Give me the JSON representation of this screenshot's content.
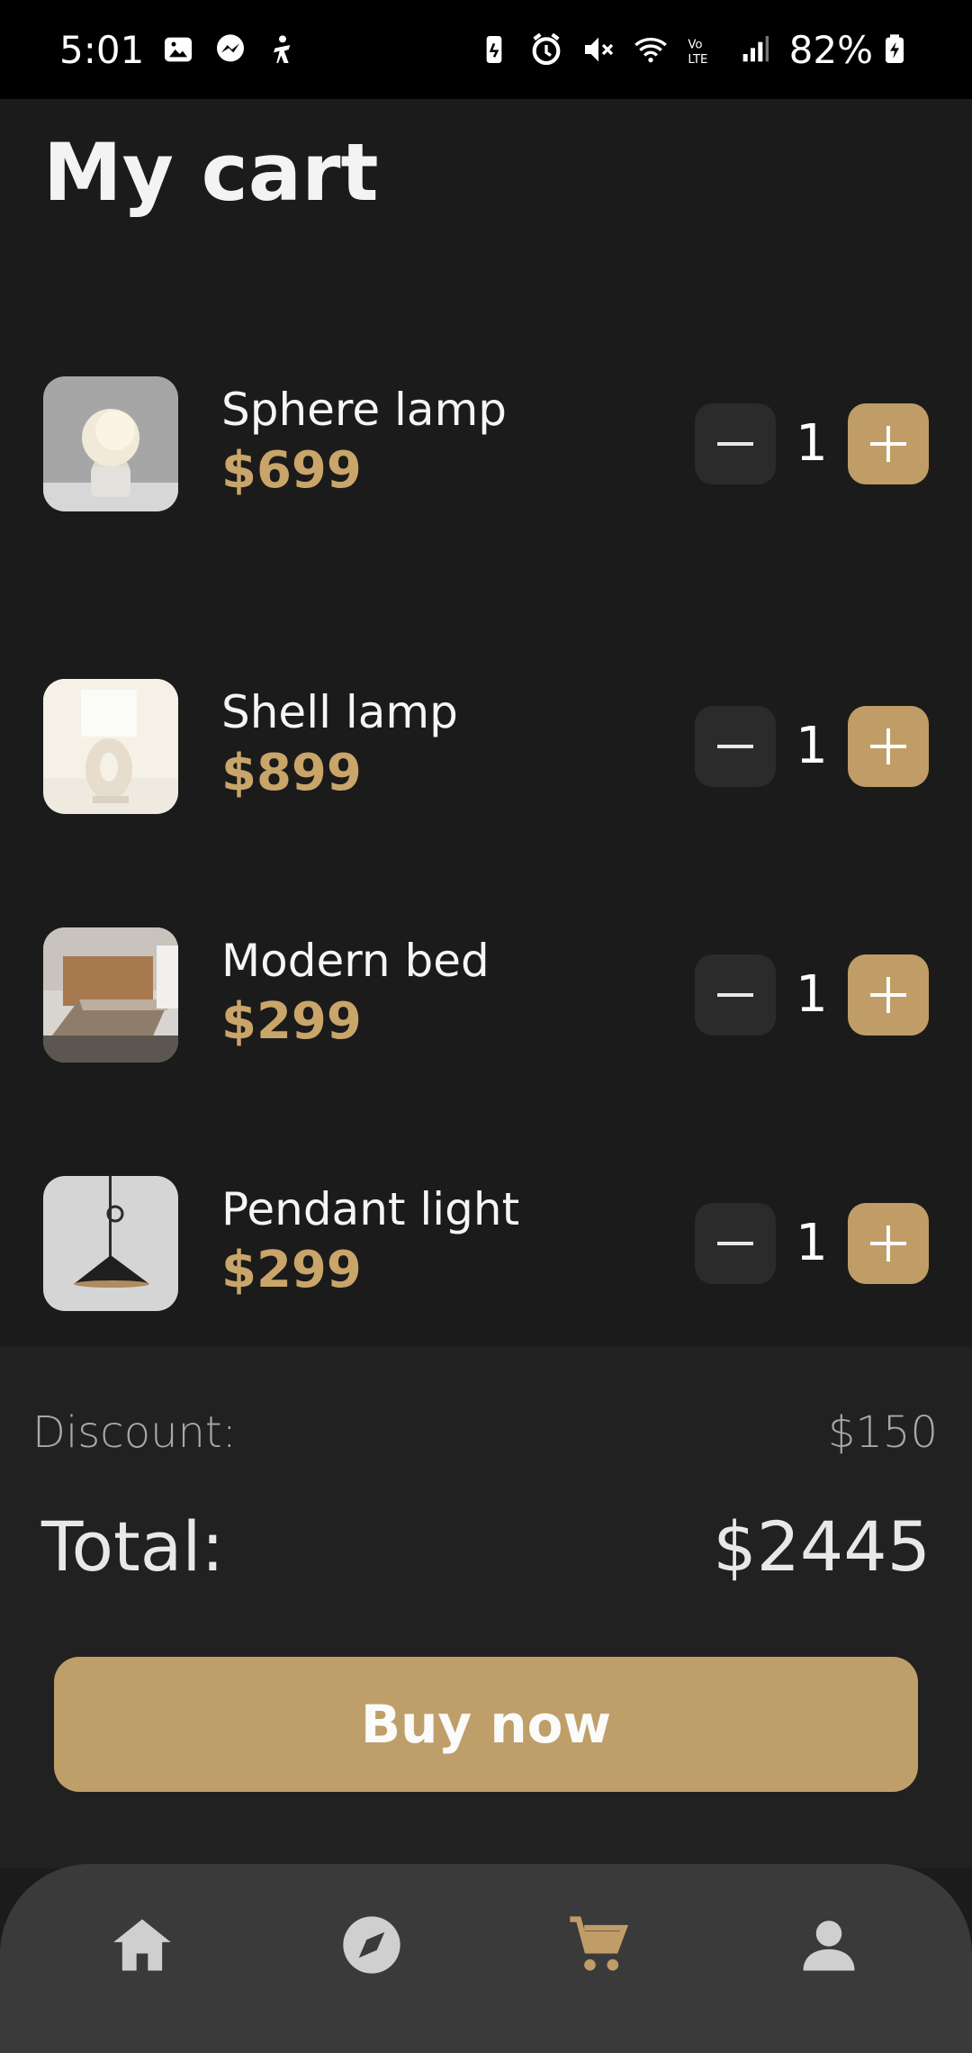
{
  "status_bar": {
    "time": "5:01",
    "battery_percent": "82%",
    "icons_left": [
      "gallery-icon",
      "messenger-icon",
      "accessibility-icon"
    ],
    "icons_right": [
      "battery-saver-icon",
      "alarm-icon",
      "mute-icon",
      "wifi-icon",
      "volte-icon",
      "signal-icon",
      "battery-charging-icon"
    ]
  },
  "page": {
    "title": "My cart"
  },
  "cart": {
    "items": [
      {
        "name": "Sphere lamp",
        "price": "$699",
        "quantity": "1"
      },
      {
        "name": "Shell lamp",
        "price": "$899",
        "quantity": "1"
      },
      {
        "name": "Modern bed",
        "price": "$299",
        "quantity": "1"
      },
      {
        "name": "Pendant light",
        "price": "$299",
        "quantity": "1"
      }
    ]
  },
  "summary": {
    "discount_label": "Discount:",
    "discount_value": "$150",
    "total_label": "Total:",
    "total_value": "$2445"
  },
  "buy_button": {
    "label": "Buy now"
  },
  "bottom_nav": {
    "items": [
      {
        "icon": "home-icon",
        "active": false
      },
      {
        "icon": "compass-icon",
        "active": false
      },
      {
        "icon": "cart-icon",
        "active": true
      },
      {
        "icon": "profile-icon",
        "active": false
      }
    ]
  },
  "colors": {
    "accent": "#c09d67",
    "price": "#c9a56a",
    "background": "#1b1b1b",
    "summary_background": "#212121",
    "nav_background": "#3a3a3a"
  }
}
